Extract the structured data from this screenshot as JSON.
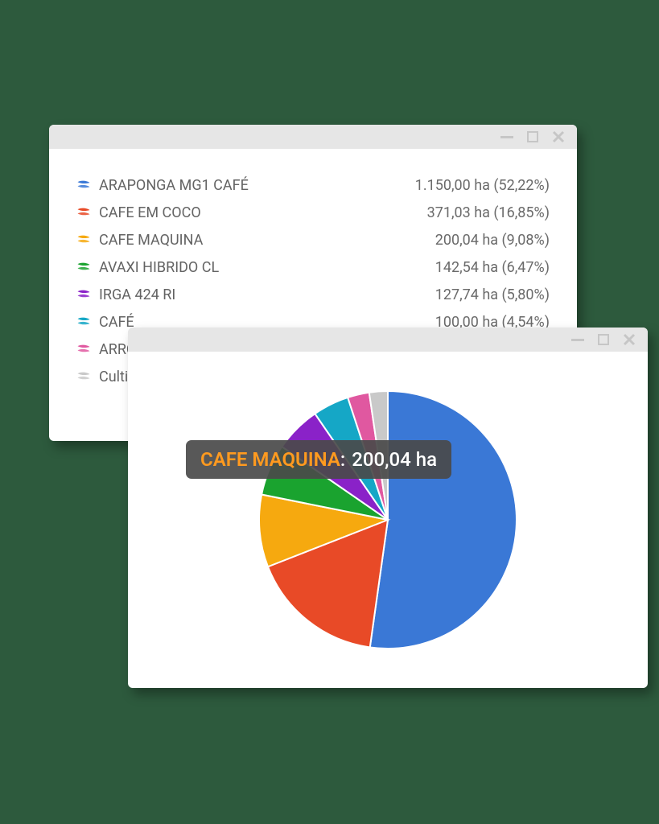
{
  "list": {
    "items": [
      {
        "label": "ARAPONGA MG1 CAFÉ",
        "value": "1.150,00 ha (52,22%)",
        "color": "#3a78d6"
      },
      {
        "label": "CAFE EM COCO",
        "value": "371,03 ha (16,85%)",
        "color": "#e84a27"
      },
      {
        "label": "CAFE MAQUINA",
        "value": "200,04 ha (9,08%)",
        "color": "#f6a90f"
      },
      {
        "label": "AVAXI HIBRIDO CL",
        "value": "142,54 ha (6,47%)",
        "color": "#1aa32f"
      },
      {
        "label": "IRGA 424 RI",
        "value": "127,74 ha (5,80%)",
        "color": "#8a22c8"
      },
      {
        "label": "CAFÉ",
        "value": "100,00 ha (4,54%)",
        "color": "#15a7c6"
      },
      {
        "label": "ARROZ",
        "value": "",
        "color": "#e058a0"
      },
      {
        "label": "Cultiva",
        "value": "",
        "color": "#c9c9c9"
      }
    ]
  },
  "tooltip": {
    "name": "CAFE MAQUINA",
    "value": "200,04 ha"
  },
  "chart_data": {
    "type": "pie",
    "title": "",
    "series": [
      {
        "name": "ARAPONGA MG1 CAFÉ",
        "value": 1150.0,
        "percent": 52.22,
        "color": "#3a78d6"
      },
      {
        "name": "CAFE EM COCO",
        "value": 371.03,
        "percent": 16.85,
        "color": "#e84a27"
      },
      {
        "name": "CAFE MAQUINA",
        "value": 200.04,
        "percent": 9.08,
        "color": "#f6a90f"
      },
      {
        "name": "AVAXI HIBRIDO CL",
        "value": 142.54,
        "percent": 6.47,
        "color": "#1aa32f"
      },
      {
        "name": "IRGA 424 RI",
        "value": 127.74,
        "percent": 5.8,
        "color": "#8a22c8"
      },
      {
        "name": "CAFÉ",
        "value": 100.0,
        "percent": 4.54,
        "color": "#15a7c6"
      },
      {
        "name": "ARROZ",
        "value": 60.0,
        "percent": 2.72,
        "color": "#e058a0"
      },
      {
        "name": "Cultiva",
        "value": 51.0,
        "percent": 2.32,
        "color": "#c9c9c9"
      }
    ],
    "unit": "ha"
  }
}
